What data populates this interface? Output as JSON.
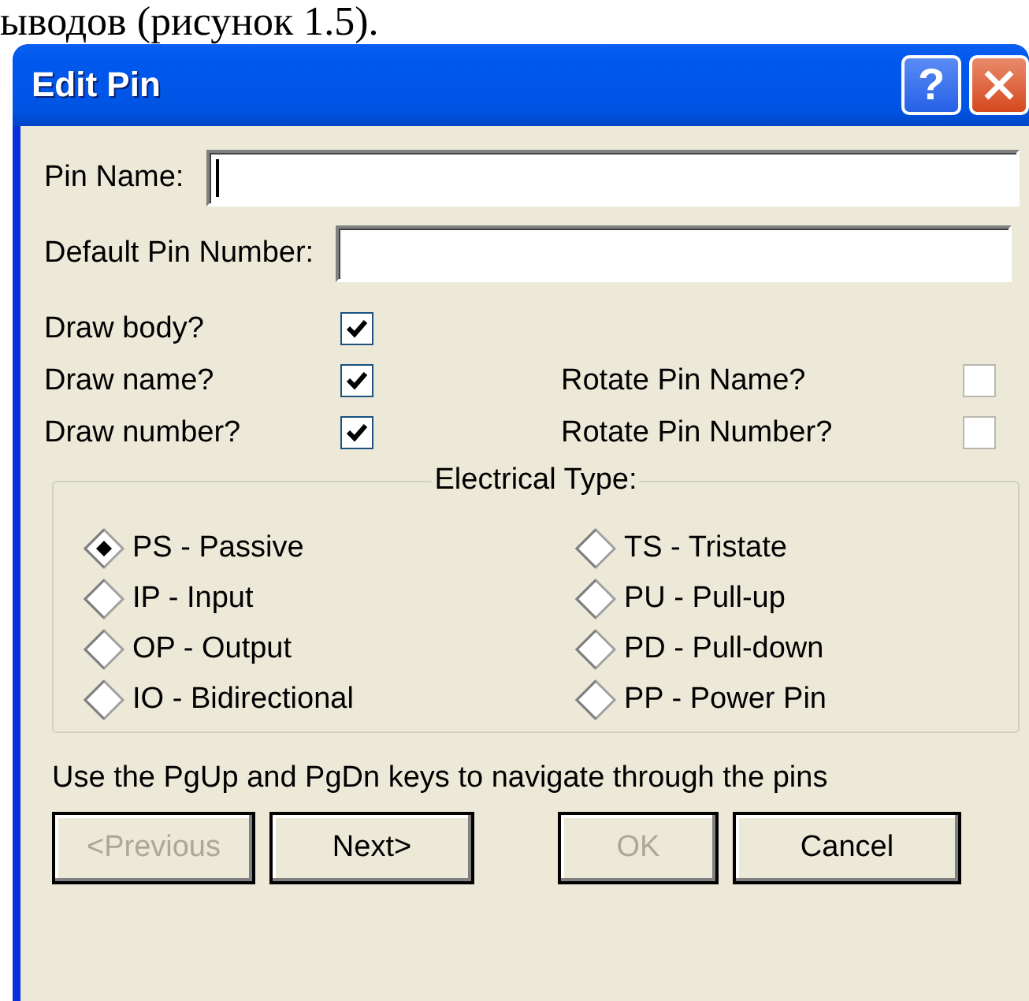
{
  "caption": {
    "text": "ыводов (рисунок 1.5)."
  },
  "window": {
    "title": "Edit Pin",
    "help": "?"
  },
  "fields": [
    {
      "label": "Pin Name:",
      "focused": true
    },
    {
      "label": "Default Pin Number:",
      "focused": false
    }
  ],
  "checkboxes_left": [
    {
      "label": "Draw body?",
      "checked": true
    },
    {
      "label": "Draw name?",
      "checked": true
    },
    {
      "label": "Draw number?",
      "checked": true
    }
  ],
  "checkboxes_right": [
    {
      "label": "Rotate Pin Name?",
      "checked": false
    },
    {
      "label": "Rotate Pin Number?",
      "checked": false
    }
  ],
  "electrical_type": {
    "legend": "Electrical Type:",
    "options": [
      {
        "label": "PS - Passive",
        "selected": true
      },
      {
        "label": "IP - Input",
        "selected": false
      },
      {
        "label": "OP - Output",
        "selected": false
      },
      {
        "label": "IO - Bidirectional",
        "selected": false
      },
      {
        "label": "TS - Tristate",
        "selected": false
      },
      {
        "label": "PU - Pull-up",
        "selected": false
      },
      {
        "label": "PD - Pull-down",
        "selected": false
      },
      {
        "label": "PP - Power Pin",
        "selected": false
      }
    ]
  },
  "hint": "Use the PgUp and PgDn keys to navigate through the pins",
  "buttons": [
    {
      "label": "<Previous",
      "disabled": true
    },
    {
      "label": "Next>",
      "disabled": false
    },
    {
      "label": "OK",
      "disabled": true
    },
    {
      "label": "Cancel",
      "disabled": false
    }
  ]
}
